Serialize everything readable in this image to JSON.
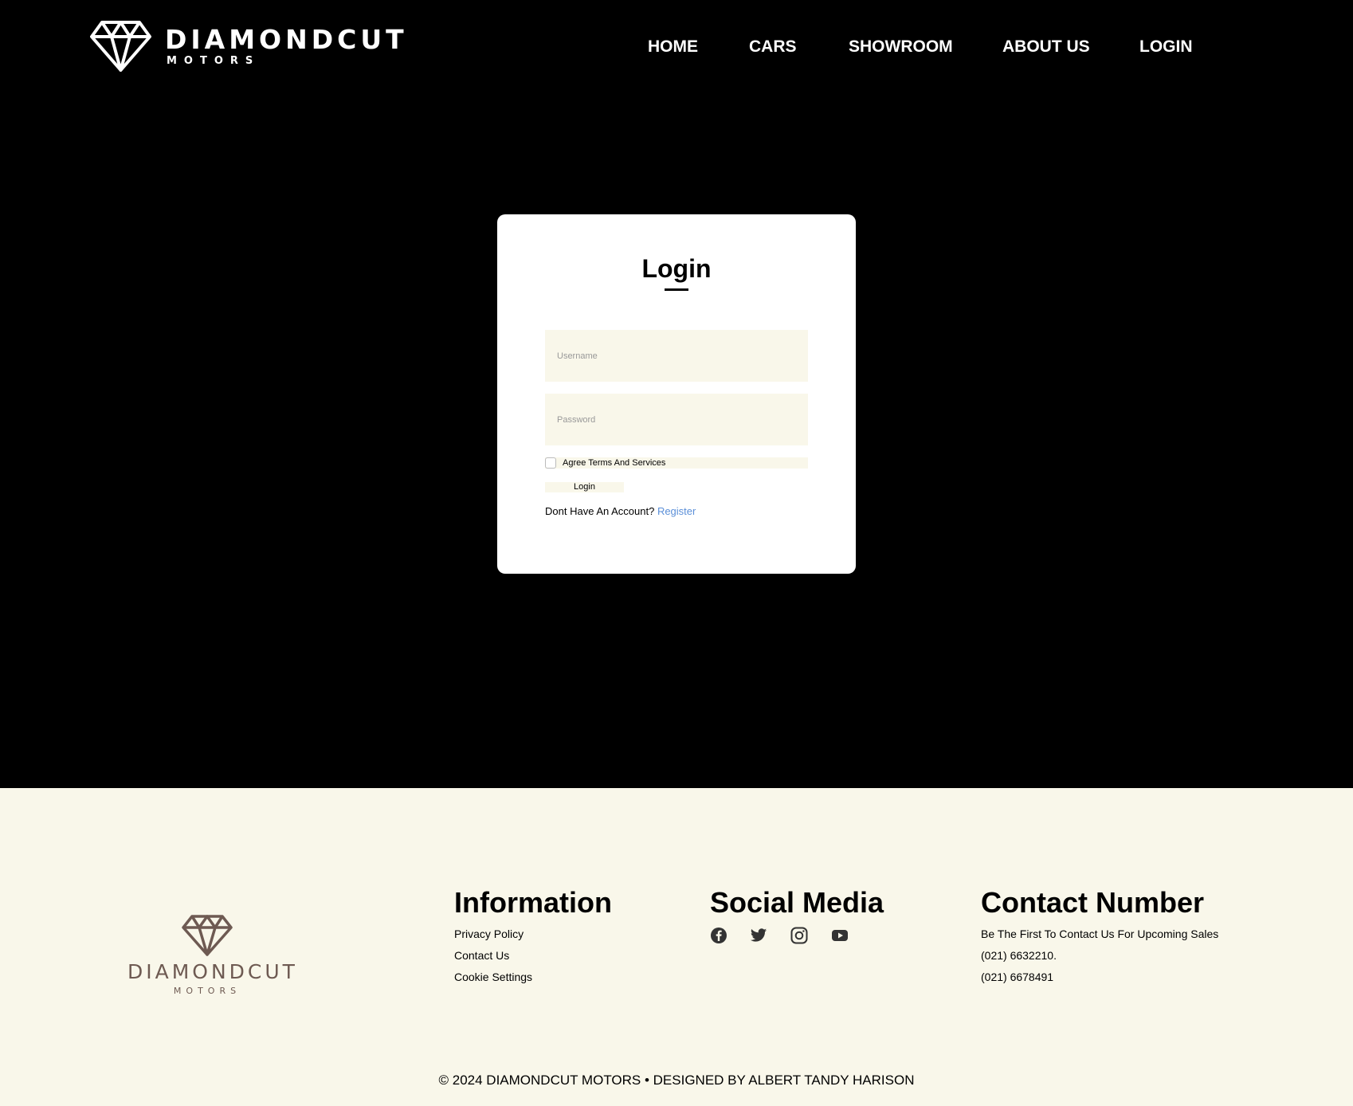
{
  "brand": {
    "name": "DIAMONDCUT",
    "sub": "MOTORS"
  },
  "nav": {
    "items": [
      "HOME",
      "CARS",
      "SHOWROOM",
      "ABOUT US",
      "LOGIN"
    ]
  },
  "login": {
    "title": "Login",
    "username_placeholder": "Username",
    "password_placeholder": "Password",
    "agree_label": "Agree Terms And Services",
    "button_label": "Login",
    "no_account_text": "Dont Have An Account?",
    "register_label": "Register"
  },
  "footer": {
    "brand_name": "DIAMONDCUT",
    "brand_sub": "MOTORS",
    "information": {
      "title": "Information",
      "links": [
        "Privacy Policy",
        "Contact Us",
        "Cookie Settings"
      ]
    },
    "social": {
      "title": "Social Media",
      "icons": [
        "facebook-icon",
        "twitter-icon",
        "instagram-icon",
        "youtube-icon"
      ]
    },
    "contact": {
      "title": "Contact Number",
      "lines": [
        "Be The First To Contact Us For Upcoming Sales",
        "(021) 6632210.",
        "(021) 6678491"
      ]
    },
    "copyright": "© 2024 DIAMONDCUT MOTORS • DESIGNED BY ALBERT TANDY HARISON"
  },
  "colors": {
    "header_bg": "#000000",
    "footer_bg": "#f9f7ea",
    "input_bg": "#f9f7ea",
    "link": "#5b8fd8",
    "footer_logo": "#6e5a52"
  }
}
